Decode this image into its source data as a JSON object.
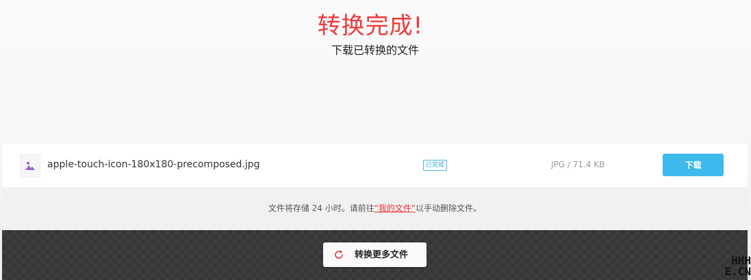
{
  "header": {
    "title": "转换完成!",
    "subtitle": "下载已转换的文件"
  },
  "file": {
    "name": "apple-touch-icon-180x180-precomposed.jpg",
    "status": "已完成",
    "meta": "JPG / 71.4 KB",
    "download_label": "下载",
    "thumb_icon": "image-icon"
  },
  "note": {
    "prefix": "文件将存储 24 小时。请前往",
    "link": "“我的文件”",
    "suffix": "以手动删除文件。"
  },
  "actions": {
    "convert_more_label": "转换更多文件",
    "convert_more_icon": "refresh-icon"
  },
  "watermark": {
    "line1": "HHH",
    "line2": "E.CN"
  },
  "colors": {
    "title": "#ef3a3a",
    "download_button": "#3db9ec",
    "status_badge": "#2aa7d6",
    "link": "#ee3131",
    "bottom_bar": "#3d3d3d"
  }
}
